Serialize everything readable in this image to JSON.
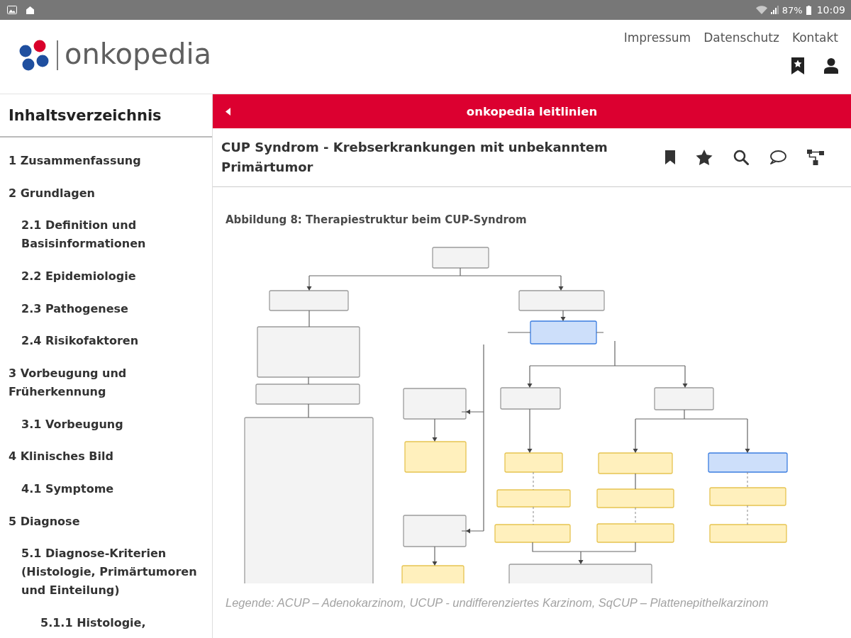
{
  "status_bar": {
    "battery": "87%",
    "time": "10:09"
  },
  "header": {
    "logo": "onkopedia",
    "links": [
      "Impressum",
      "Datenschutz",
      "Kontakt"
    ]
  },
  "sidebar": {
    "title": "Inhaltsverzeichnis",
    "items": [
      {
        "number": "1",
        "title": "Zusammenfassung"
      },
      {
        "number": "2",
        "title": "Grundlagen",
        "children": [
          {
            "number": "2.1",
            "title": "Definition und Basisinformationen"
          },
          {
            "number": "2.2",
            "title": "Epidemiologie"
          },
          {
            "number": "2.3",
            "title": "Pathogenese"
          },
          {
            "number": "2.4",
            "title": "Risikofaktoren"
          }
        ]
      },
      {
        "number": "3",
        "title": "Vorbeugung und Früherkennung",
        "children": [
          {
            "number": "3.1",
            "title": "Vorbeugung"
          }
        ]
      },
      {
        "number": "4",
        "title": "Klinisches Bild",
        "children": [
          {
            "number": "4.1",
            "title": "Symptome"
          }
        ]
      },
      {
        "number": "5",
        "title": "Diagnose",
        "children": [
          {
            "number": "5.1",
            "title": "Diagnose-Kriterien (Histologie, Primärtumoren und Einteilung)",
            "children": [
              {
                "number": "5.1.1",
                "title": "Histologie,"
              }
            ]
          }
        ]
      }
    ]
  },
  "banner": {
    "title": "onkopedia leitlinien"
  },
  "document": {
    "title": "CUP Syndrom - Krebserkrankungen mit unbekanntem Primärtumor"
  },
  "figure": {
    "title": "Abbildung 8: Therapiestruktur beim CUP-Syndrom",
    "caption": "Legende: ACUP – Adenokarzinom, UCUP - undifferenziertes Karzinom, SqCUP – Plattenepithelkarzinom"
  }
}
